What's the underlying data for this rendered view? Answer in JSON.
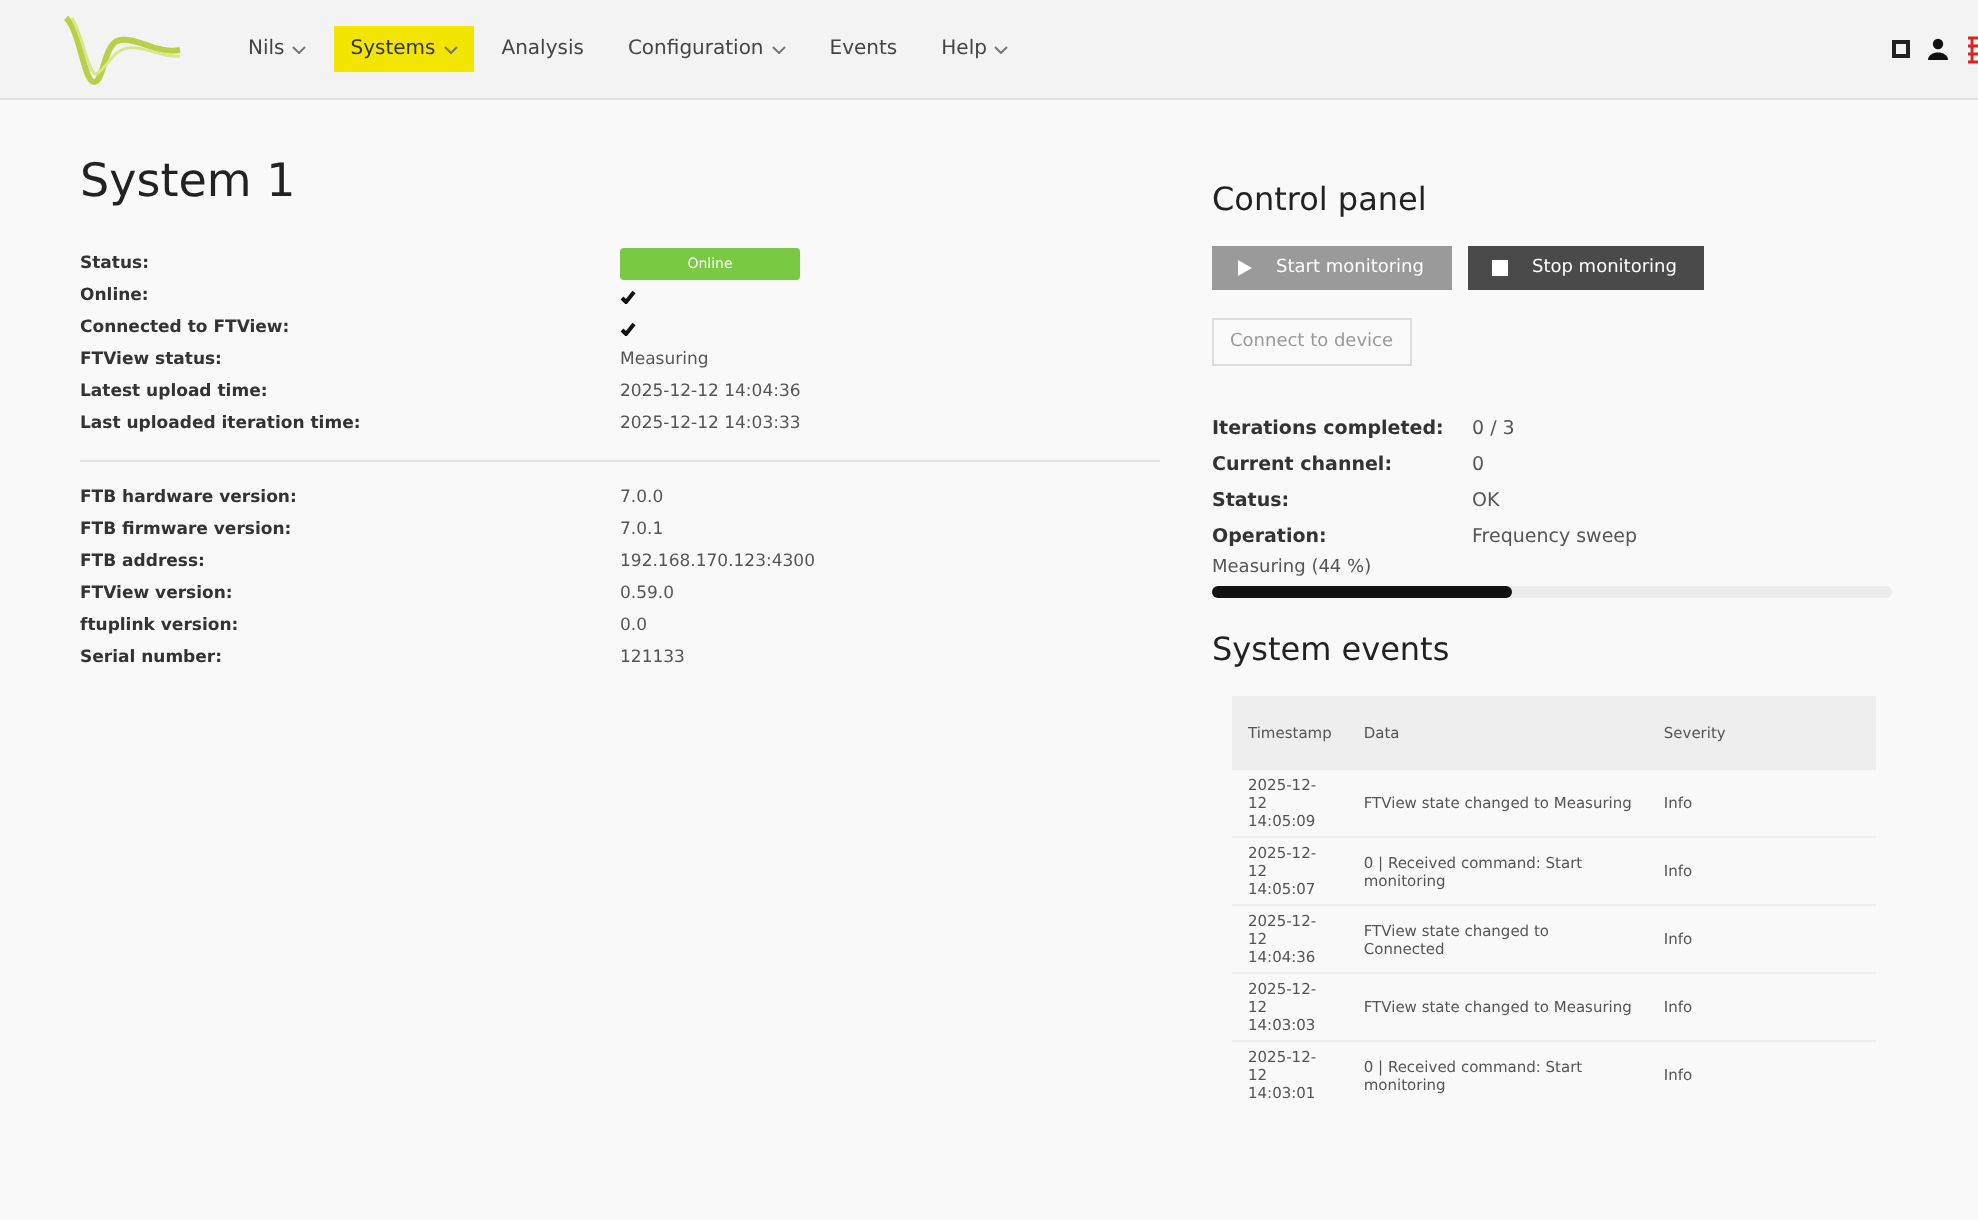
{
  "nav": {
    "items": [
      {
        "label": "Nils",
        "dropdown": true,
        "selected": false
      },
      {
        "label": "Systems",
        "dropdown": true,
        "selected": true
      },
      {
        "label": "Analysis",
        "dropdown": false,
        "selected": false
      },
      {
        "label": "Configuration",
        "dropdown": true,
        "selected": false
      },
      {
        "label": "Events",
        "dropdown": false,
        "selected": false
      },
      {
        "label": "Help",
        "dropdown": true,
        "selected": false
      }
    ]
  },
  "system": {
    "title": "System 1",
    "groups": [
      [
        {
          "label": "Status:",
          "kind": "badge",
          "value": "Online",
          "color": "#7ac943"
        },
        {
          "label": "Online:",
          "kind": "check",
          "checked": true
        },
        {
          "label": "Connected to FTView:",
          "kind": "check",
          "checked": true
        },
        {
          "label": "FTView status:",
          "kind": "text",
          "value": "Measuring"
        },
        {
          "label": "Latest upload time:",
          "kind": "text",
          "value": "2025-12-12 14:04:36"
        },
        {
          "label": "Last uploaded iteration time:",
          "kind": "text",
          "value": "2025-12-12 14:03:33"
        }
      ],
      [
        {
          "label": "FTB hardware version:",
          "kind": "text",
          "value": "7.0.0"
        },
        {
          "label": "FTB firmware version:",
          "kind": "text",
          "value": "7.0.1"
        },
        {
          "label": "FTB address:",
          "kind": "text",
          "value": "192.168.170.123:4300"
        },
        {
          "label": "FTView version:",
          "kind": "text",
          "value": "0.59.0"
        },
        {
          "label": "ftuplink version:",
          "kind": "text",
          "value": "0.0"
        },
        {
          "label": "Serial number:",
          "kind": "text",
          "value": "121133"
        }
      ]
    ]
  },
  "control_panel": {
    "title": "Control panel",
    "buttons": [
      {
        "label": "Start monitoring",
        "kind": "play",
        "disabled": true
      },
      {
        "label": "Stop monitoring",
        "kind": "stop",
        "disabled": false
      }
    ],
    "connect_button": {
      "label": "Connect to device",
      "disabled": true
    },
    "stats": [
      {
        "label": "Iterations completed:",
        "value": "0 / 3"
      },
      {
        "label": "Current channel:",
        "value": "0"
      },
      {
        "label": "Status:",
        "value": "OK"
      },
      {
        "label": "Operation:",
        "value": "Frequency sweep"
      }
    ],
    "progress": {
      "label": "Measuring (44 %)",
      "level": 0.44
    }
  },
  "events": {
    "title": "System events",
    "columns": [
      "Timestamp",
      "Data",
      "Severity"
    ],
    "rows": [
      [
        "2025-12-12 14:05:09",
        "FTView state changed to Measuring",
        "Info"
      ],
      [
        "2025-12-12 14:05:07",
        "0 | Received command: Start monitoring",
        "Info"
      ],
      [
        "2025-12-12 14:04:36",
        "FTView state changed to Connected",
        "Info"
      ],
      [
        "2025-12-12 14:03:03",
        "FTView state changed to Measuring",
        "Info"
      ],
      [
        "2025-12-12 14:03:01",
        "0 | Received command: Start monitoring",
        "Info"
      ]
    ]
  }
}
